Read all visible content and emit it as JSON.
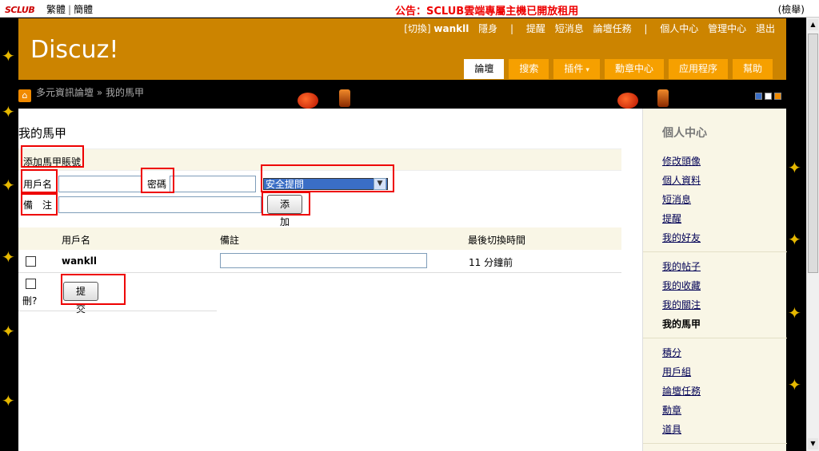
{
  "topbar": {
    "logo": "SCLUB",
    "lang_traditional": "繁體",
    "lang_simplified": "簡體",
    "announcement": "公告：SCLUB雲端專屬主機已開放租用",
    "report": "(檢舉)"
  },
  "header": {
    "brand": "Discuz!",
    "user_nav": {
      "switch": "[切換]",
      "username": "wankll",
      "invisible": "隱身",
      "remind": "提醒",
      "messages": "短消息",
      "tasks": "論壇任務",
      "personal_center": "個人中心",
      "admin_center": "管理中心",
      "logout": "退出"
    },
    "tabs": [
      "論壇",
      "搜索",
      "插件",
      "勳章中心",
      "应用程序",
      "幫助"
    ],
    "plugins_chevron": "▾"
  },
  "breadcrumb": {
    "home_icon": "home-icon",
    "forum": "多元資訊論壇",
    "separator": "»",
    "current": "我的馬甲"
  },
  "main": {
    "title": "我的馬甲",
    "add_section": "添加馬甲賬號",
    "username_label": "用戶名",
    "username_value": "",
    "password_label": "密碼",
    "password_value": "",
    "question_selected": "安全提問",
    "note_label": "備　注",
    "note_value": "",
    "add_button": "添加",
    "table": {
      "headers": [
        "用戶名",
        "備註",
        "最後切換時間"
      ],
      "rows": [
        {
          "username": "wankll",
          "note": "",
          "last_switch": "11 分鐘前"
        }
      ]
    },
    "delete_label": "刪?",
    "submit_button": "提交"
  },
  "sidebar": {
    "title": "個人中心",
    "group1": [
      "修改頭像",
      "個人資料",
      "短消息",
      "提醒",
      "我的好友"
    ],
    "group2": [
      "我的帖子",
      "我的收藏",
      "我的關注"
    ],
    "current": "我的馬甲",
    "group3": [
      "積分",
      "用戶組",
      "論壇任務",
      "勳章",
      "道具"
    ]
  },
  "colors": {
    "header_bg": "#cc8400",
    "tab_bg": "#f6a000",
    "announcement": "#ee0000",
    "highlight_box": "#ee0000",
    "sidebar_bg": "#f9f6e6"
  }
}
